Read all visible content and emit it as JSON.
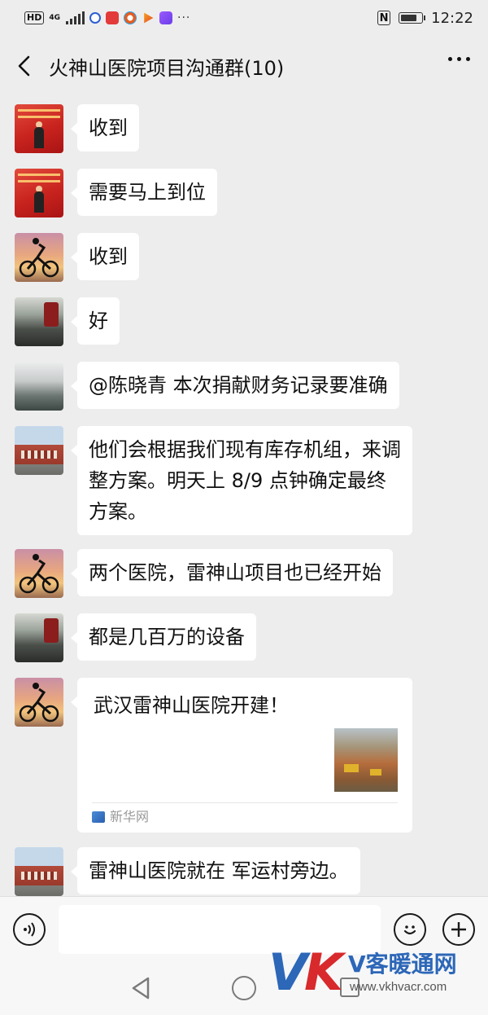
{
  "status_bar": {
    "hd_label": "HD",
    "network_label": "4G",
    "time": "12:22",
    "nfc_label": "N",
    "battery_level": 0.8,
    "overflow_dots": "···"
  },
  "header": {
    "title": "火神山医院项目沟通群(10)"
  },
  "messages": [
    {
      "avatar": "red-poster",
      "text": "收到"
    },
    {
      "avatar": "red-poster",
      "text": "需要马上到位"
    },
    {
      "avatar": "cyclist",
      "text": "收到"
    },
    {
      "avatar": "car-interior",
      "text": "好"
    },
    {
      "avatar": "misty-mountain",
      "text": "@陈晓青  本次捐献财务记录要准确"
    },
    {
      "avatar": "building",
      "text": "他们会根据我们现有库存机组，来调整方案。明天上 8/9 点钟确定最终方案。"
    },
    {
      "avatar": "cyclist",
      "text": "两个医院，雷神山项目也已经开始"
    },
    {
      "avatar": "car-interior",
      "text": "都是几百万的设备"
    },
    {
      "avatar": "cyclist",
      "link_card": {
        "title": "武汉雷神山医院开建！",
        "source": "新华网"
      }
    },
    {
      "avatar": "building",
      "text": "雷神山医院就在 军运村旁边。"
    }
  ],
  "input_bar": {
    "placeholder": ""
  },
  "watermark": {
    "logo_v": "V",
    "logo_k": "K",
    "name": "V客暖通网",
    "url": "www.vkhvacr.com"
  },
  "colors": {
    "background": "#ededed",
    "bubble": "#ffffff",
    "watermark_blue": "#2c67b8",
    "watermark_red": "#d8292c"
  }
}
